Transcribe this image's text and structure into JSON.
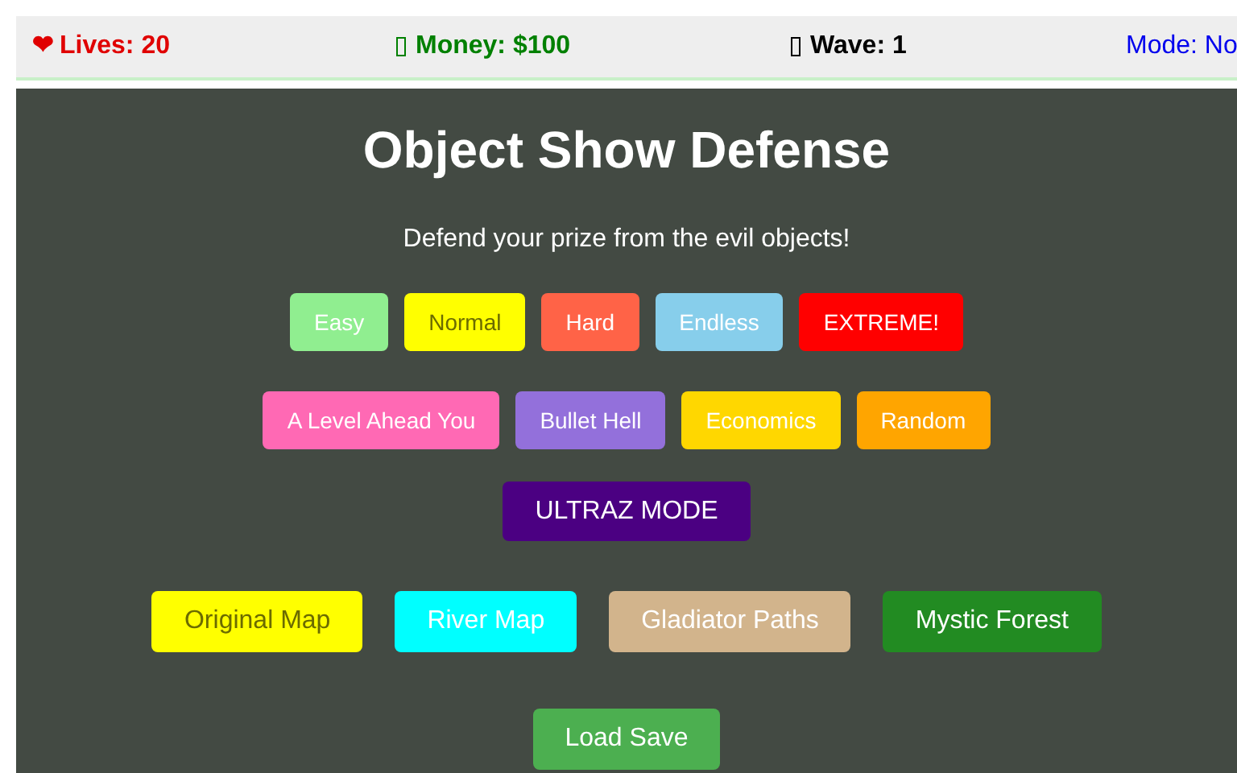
{
  "stats": [
    {
      "kind": "heart",
      "icon": "❤",
      "label": "Lives: 20",
      "color": "#e00000"
    },
    {
      "kind": "box",
      "label": "Money: $100",
      "color": "#008000"
    },
    {
      "kind": "box",
      "label": "Wave: 1",
      "color": "#000000"
    },
    {
      "kind": "plain",
      "label": "Mode: No",
      "color": "#0000ee"
    }
  ],
  "title": "Object Show Defense",
  "subtitle": "Defend your prize from the evil objects!",
  "mode_rows": [
    [
      {
        "kind": "dark",
        "label": "Easy",
        "color": "#90ee90"
      },
      {
        "kind": "light",
        "label": "Normal",
        "color": "#ffff00"
      },
      {
        "kind": "dark",
        "label": "Hard",
        "color": "#ff6347"
      },
      {
        "kind": "dark",
        "label": "Endless",
        "color": "#87ceeb"
      },
      {
        "kind": "dark",
        "label": "EXTREME!",
        "color": "#ff0000"
      }
    ],
    [
      {
        "kind": "dark",
        "label": "A Level Ahead You",
        "color": "#ff69b4"
      },
      {
        "kind": "dark",
        "label": "Bullet Hell",
        "color": "#9370db"
      },
      {
        "kind": "dark",
        "label": "Economics",
        "color": "#ffd700"
      },
      {
        "kind": "dark",
        "label": "Random",
        "color": "#ffa500"
      }
    ]
  ],
  "special_mode": {
    "label": "ULTRAZ MODE",
    "color": "#4b0082"
  },
  "maps": [
    {
      "kind": "light",
      "label": "Original Map",
      "color": "#ffff00"
    },
    {
      "kind": "dark",
      "label": "River Map",
      "color": "#00ffff"
    },
    {
      "kind": "dark",
      "label": "Gladiator Paths",
      "color": "#d2b48c"
    },
    {
      "kind": "dark",
      "label": "Mystic Forest",
      "color": "#228b22"
    }
  ],
  "load_button": {
    "label": "Load Save",
    "color": "#4caf50"
  }
}
